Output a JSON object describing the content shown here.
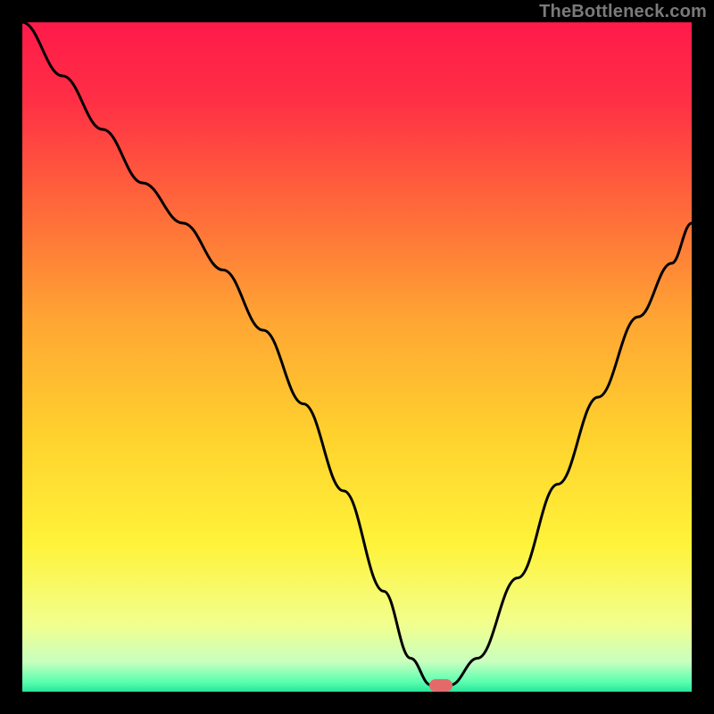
{
  "watermark": "TheBottleneck.com",
  "colors": {
    "marker": "#e46a6a",
    "curve": "#000000",
    "frame": "#000000"
  },
  "marker": {
    "x_pct": 62.5,
    "y_pct": 99.0
  },
  "chart_data": {
    "type": "line",
    "title": "",
    "xlabel": "",
    "ylabel": "",
    "xlim": [
      0,
      100
    ],
    "ylim": [
      0,
      100
    ],
    "background_gradient_stops": [
      {
        "offset": 0.0,
        "color": "#ff1a4a"
      },
      {
        "offset": 0.12,
        "color": "#ff3045"
      },
      {
        "offset": 0.28,
        "color": "#ff6a3a"
      },
      {
        "offset": 0.45,
        "color": "#ffa733"
      },
      {
        "offset": 0.62,
        "color": "#ffd22e"
      },
      {
        "offset": 0.78,
        "color": "#fff33a"
      },
      {
        "offset": 0.9,
        "color": "#f1ff8e"
      },
      {
        "offset": 0.955,
        "color": "#c9ffbf"
      },
      {
        "offset": 0.985,
        "color": "#5dffb0"
      },
      {
        "offset": 1.0,
        "color": "#28e59a"
      }
    ],
    "series": [
      {
        "name": "bottleneck-curve",
        "x": [
          0,
          6,
          12,
          18,
          24,
          30,
          36,
          42,
          48,
          54,
          58,
          61,
          64,
          68,
          74,
          80,
          86,
          92,
          97,
          100
        ],
        "y": [
          100,
          92,
          84,
          76,
          70,
          63,
          54,
          43,
          30,
          15,
          5,
          1,
          1,
          5,
          17,
          31,
          44,
          56,
          64,
          70
        ]
      }
    ],
    "marker": {
      "x": 62.5,
      "y": 1
    },
    "annotations": []
  }
}
